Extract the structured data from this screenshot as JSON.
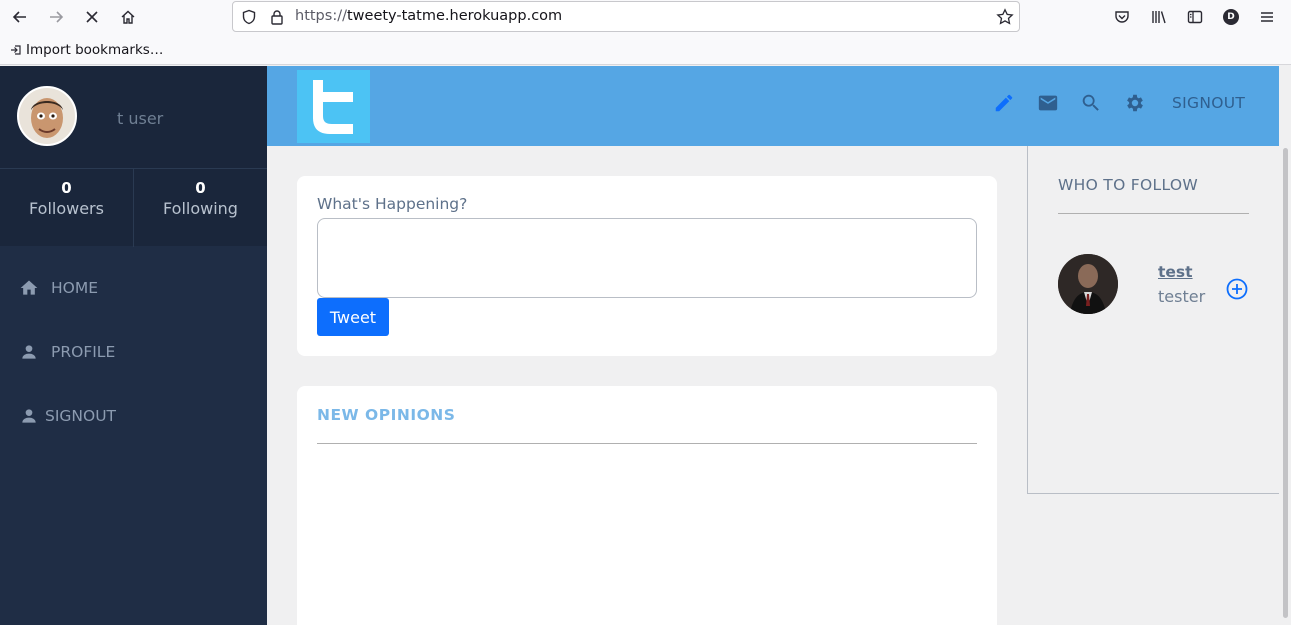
{
  "browser": {
    "url_protocol": "https://",
    "url_host": "tweety-tatme.herokuapp.com",
    "bookmark_label": "Import bookmarks…",
    "profile_letter": "D"
  },
  "sidebar": {
    "username": "t user",
    "followers_count": "0",
    "followers_label": "Followers",
    "following_count": "0",
    "following_label": "Following",
    "nav": [
      {
        "label": "HOME"
      },
      {
        "label": "PROFILE"
      },
      {
        "label": "SIGNOUT"
      }
    ]
  },
  "header": {
    "signout_label": "SIGNOUT"
  },
  "compose": {
    "label": "What's Happening?",
    "value": "",
    "button_label": "Tweet"
  },
  "opinions": {
    "title": "NEW OPINIONS"
  },
  "follow": {
    "title": "WHO TO FOLLOW",
    "users": [
      {
        "name": "test",
        "handle": "tester"
      }
    ]
  },
  "colors": {
    "sidebar_bg": "#1f2d45",
    "header_bg": "#55a6e4",
    "accent": "#0d6efd"
  }
}
